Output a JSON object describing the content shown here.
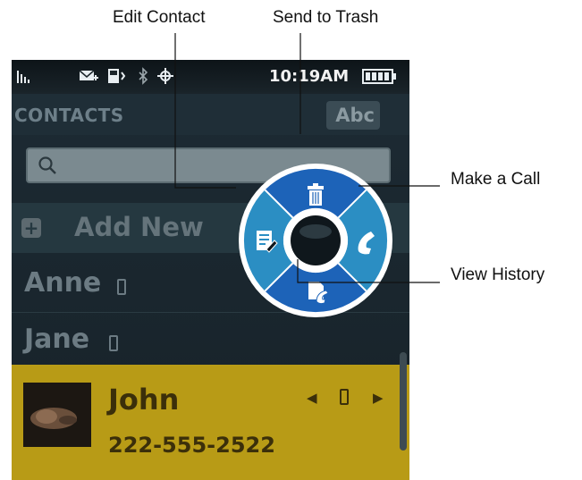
{
  "callouts": {
    "edit_contact": "Edit Contact",
    "send_to_trash": "Send to Trash",
    "make_a_call": "Make a Call",
    "view_history": "View History"
  },
  "statusbar": {
    "time": "10:19AM",
    "icons": [
      "signal-icon",
      "message-icon",
      "vibrate-icon",
      "bluetooth-icon",
      "gps-icon",
      "battery-icon"
    ]
  },
  "header": {
    "title": "CONTACTS",
    "sort_label": "Abc"
  },
  "search": {
    "placeholder": "",
    "icon": "search-icon"
  },
  "add_new": {
    "label": "Add New",
    "icon": "plus-icon"
  },
  "contacts": [
    {
      "name": "Anne",
      "type_icon": "mobile-phone-icon"
    },
    {
      "name": "Jane",
      "type_icon": "mobile-phone-icon"
    }
  ],
  "selected_contact": {
    "name": "John",
    "number": "222-555-2522",
    "type_icon": "mobile-phone-icon"
  },
  "quick_dial": {
    "actions": [
      "trash-icon",
      "edit-contact-icon",
      "make-call-icon",
      "view-history-icon"
    ],
    "colors": {
      "ring": "#1d63b8",
      "sides": "#2b8ec3",
      "outline": "#ffffff"
    }
  },
  "colors": {
    "background": "#172229",
    "highlight": "#b89b16",
    "text_dim": "#6c7b83"
  }
}
